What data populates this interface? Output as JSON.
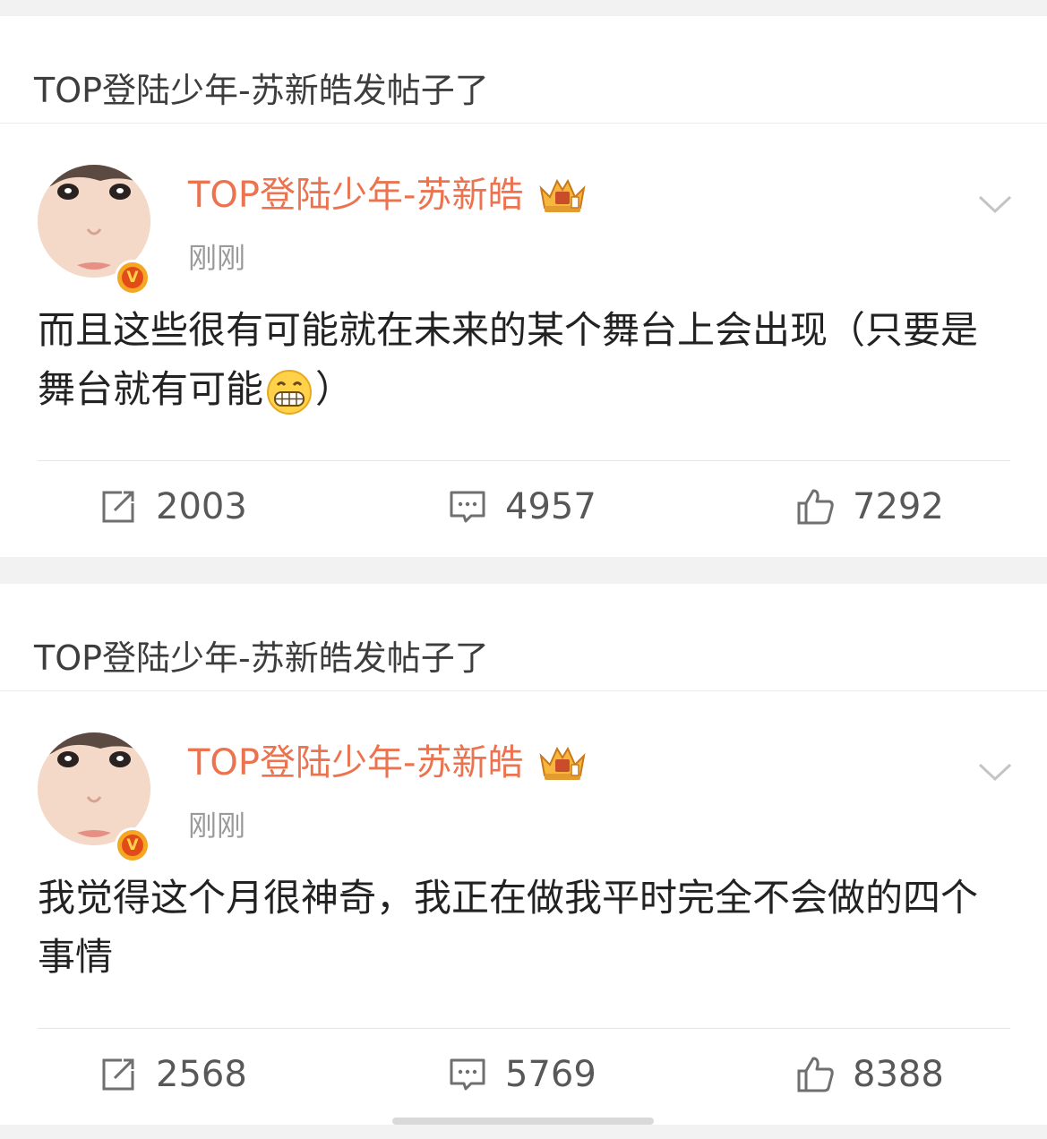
{
  "posts": [
    {
      "header": "TOP登陆少年-苏新皓发帖子了",
      "author": "TOP登陆少年-苏新皓",
      "verified_badge": "V",
      "timestamp": "刚刚",
      "text_before_emoji": "而且这些很有可能就在未来的某个舞台上会出现（只要是舞台就有可能",
      "emoji": "grin-emoji",
      "text_after_emoji": "）",
      "reposts": "2003",
      "comments": "4957",
      "likes": "7292"
    },
    {
      "header": "TOP登陆少年-苏新皓发帖子了",
      "author": "TOP登陆少年-苏新皓",
      "verified_badge": "V",
      "timestamp": "刚刚",
      "text_before_emoji": "我觉得这个月很神奇，我正在做我平时完全不会做的四个事情",
      "emoji": "",
      "text_after_emoji": "",
      "reposts": "2568",
      "comments": "5769",
      "likes": "8388"
    }
  ],
  "colors": {
    "author": "#eb7350",
    "background": "#f2f2f2",
    "card": "#ffffff",
    "muted": "#9a9a9a",
    "verified_badge": "#f5a623"
  },
  "icons": [
    "repost-icon",
    "comment-icon",
    "like-icon",
    "chevron-down-icon",
    "crown-icon",
    "verified-badge-icon",
    "grin-emoji"
  ]
}
